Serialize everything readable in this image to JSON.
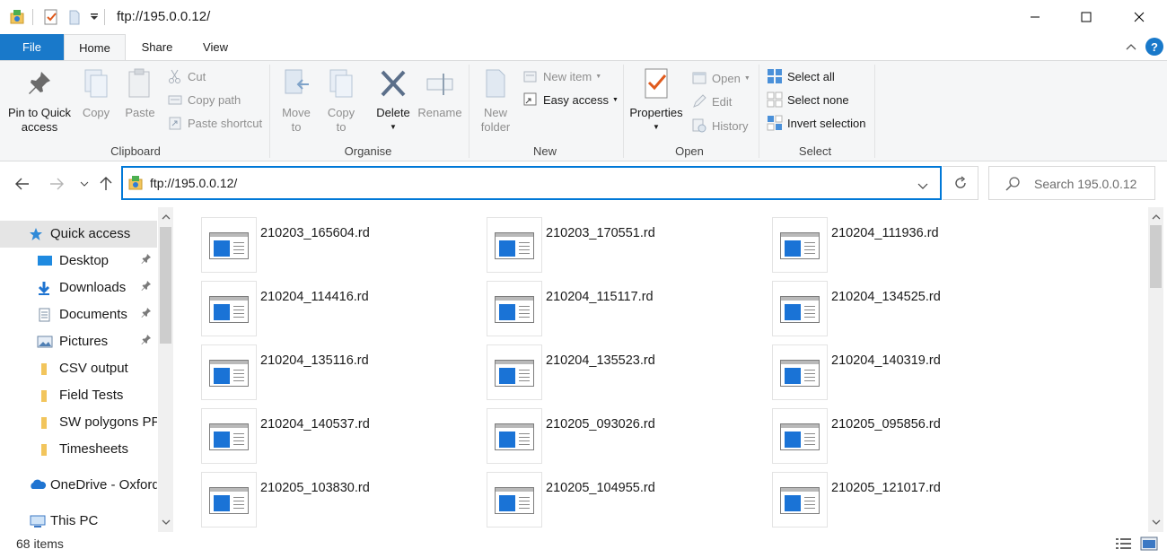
{
  "window": {
    "title": "ftp://195.0.0.12/",
    "controls": [
      "minimize",
      "maximize",
      "close"
    ]
  },
  "ribbon_tabs": {
    "file": "File",
    "home": "Home",
    "share": "Share",
    "view": "View",
    "active": "Home"
  },
  "ribbon": {
    "clipboard": {
      "group_label": "Clipboard",
      "pin_line1": "Pin to Quick",
      "pin_line2": "access",
      "copy": "Copy",
      "paste": "Paste",
      "cut": "Cut",
      "copy_path": "Copy path",
      "paste_shortcut": "Paste shortcut"
    },
    "organise": {
      "group_label": "Organise",
      "move_line1": "Move",
      "move_line2": "to",
      "copy_line1": "Copy",
      "copy_line2": "to",
      "delete": "Delete",
      "rename": "Rename"
    },
    "new": {
      "group_label": "New",
      "new_folder_line1": "New",
      "new_folder_line2": "folder",
      "new_item": "New item",
      "easy_access": "Easy access"
    },
    "open": {
      "group_label": "Open",
      "properties": "Properties",
      "open": "Open",
      "edit": "Edit",
      "history": "History"
    },
    "select": {
      "group_label": "Select",
      "select_all": "Select all",
      "select_none": "Select none",
      "invert_selection": "Invert selection"
    }
  },
  "address_bar": {
    "path": "ftp://195.0.0.12/",
    "search_placeholder": "Search 195.0.0.12"
  },
  "nav_pane": {
    "items": [
      {
        "label": "Quick access",
        "icon": "star-icon",
        "pinned": false,
        "selected": true
      },
      {
        "label": "Desktop",
        "icon": "desktop-icon",
        "pinned": true
      },
      {
        "label": "Downloads",
        "icon": "download-icon",
        "pinned": true
      },
      {
        "label": "Documents",
        "icon": "documents-icon",
        "pinned": true
      },
      {
        "label": "Pictures",
        "icon": "pictures-icon",
        "pinned": true
      },
      {
        "label": "CSV output",
        "icon": "folder-icon",
        "pinned": false
      },
      {
        "label": "Field Tests",
        "icon": "folder-icon",
        "pinned": false
      },
      {
        "label": "SW polygons PP",
        "icon": "folder-icon",
        "pinned": false
      },
      {
        "label": "Timesheets",
        "icon": "folder-icon",
        "pinned": false
      },
      {
        "label": "OneDrive - Oxford",
        "icon": "onedrive-icon",
        "pinned": false
      },
      {
        "label": "This PC",
        "icon": "this-pc-icon",
        "pinned": false
      }
    ]
  },
  "files": [
    "210203_165604.rd",
    "210203_170551.rd",
    "210204_111936.rd",
    "210204_114416.rd",
    "210204_115117.rd",
    "210204_134525.rd",
    "210204_135116.rd",
    "210204_135523.rd",
    "210204_140319.rd",
    "210204_140537.rd",
    "210205_093026.rd",
    "210205_095856.rd",
    "210205_103830.rd",
    "210205_104955.rd",
    "210205_121017.rd"
  ],
  "status": {
    "item_count": "68 items"
  },
  "colors": {
    "accent": "#1979ca",
    "address_focus": "#0078d7",
    "file_icon_blue": "#1a73d6",
    "selected_nav": "#e5e5e5"
  }
}
